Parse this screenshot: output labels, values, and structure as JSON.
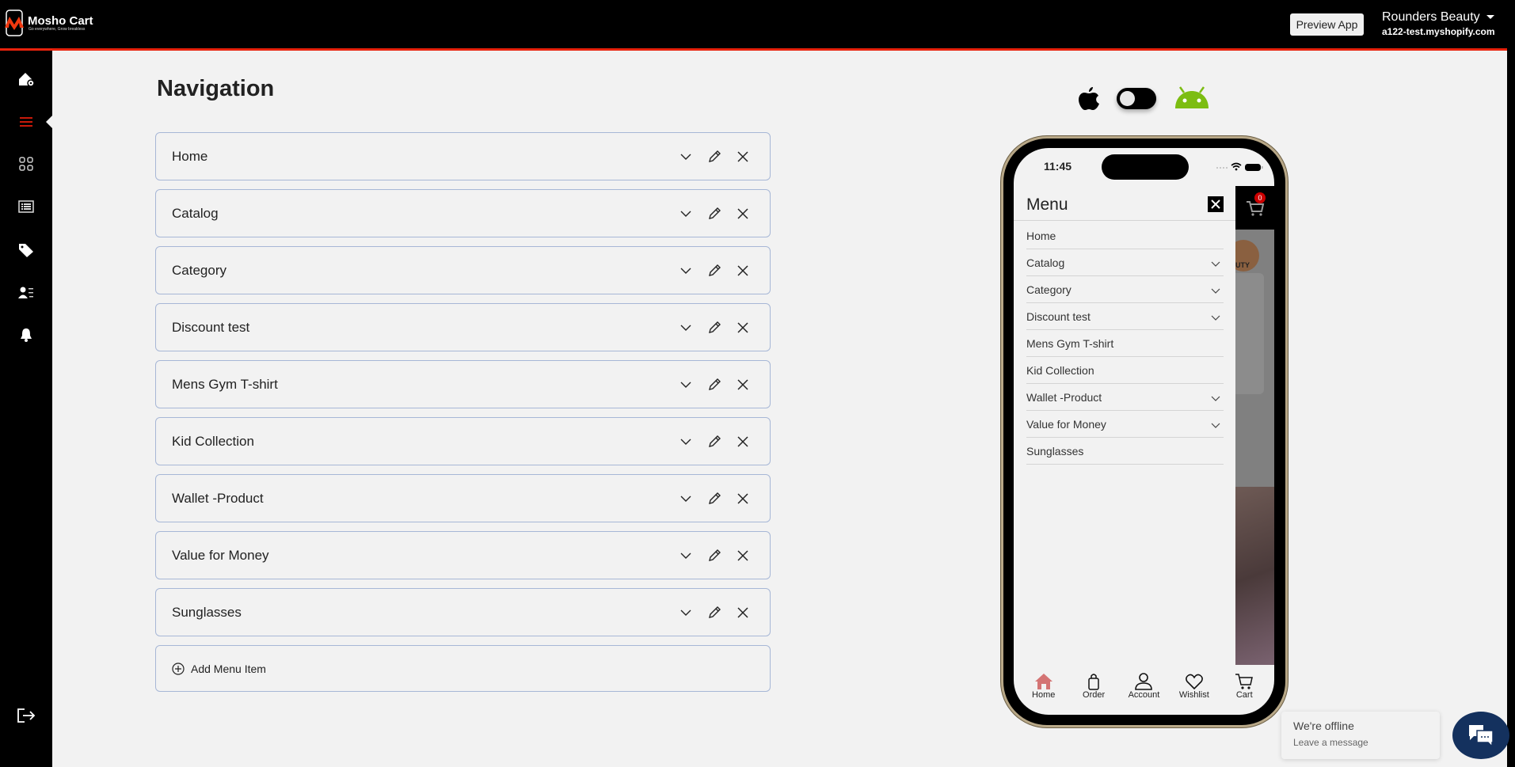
{
  "header": {
    "brand": "Mosho Cart",
    "tagline": "Go everywhere, Grow breakless",
    "preview_label": "Preview App",
    "store_name": "Rounders Beauty",
    "store_domain": "a122-test.myshopify.com",
    "accent": "#e8220c"
  },
  "sidebar": {
    "items": [
      {
        "icon": "home-settings-icon"
      },
      {
        "icon": "menu-icon",
        "active": true
      },
      {
        "icon": "grid-icon"
      },
      {
        "icon": "list-icon"
      },
      {
        "icon": "tag-icon"
      },
      {
        "icon": "user-list-icon"
      },
      {
        "icon": "bell-icon"
      }
    ],
    "logout_icon": "logout-icon"
  },
  "page": {
    "title": "Navigation",
    "items": [
      "Home",
      "Catalog",
      "Category",
      "Discount test",
      "Mens Gym T-shirt",
      "Kid Collection",
      "Wallet -Product",
      "Value for Money",
      "Sunglasses"
    ],
    "add_label": "Add Menu Item"
  },
  "platform": {
    "selected": "ios",
    "ios_icon": "apple-icon",
    "android_icon": "android-icon",
    "android_color": "#7cbd12"
  },
  "phone": {
    "time": "11:45",
    "menu_title": "Menu",
    "cart_badge": "0",
    "peek_text": "UTY",
    "menu_items": [
      {
        "label": "Home",
        "expandable": false
      },
      {
        "label": "Catalog",
        "expandable": true
      },
      {
        "label": "Category",
        "expandable": true
      },
      {
        "label": "Discount test",
        "expandable": true
      },
      {
        "label": "Mens Gym T-shirt",
        "expandable": false
      },
      {
        "label": "Kid Collection",
        "expandable": false
      },
      {
        "label": "Wallet -Product",
        "expandable": true
      },
      {
        "label": "Value for Money",
        "expandable": true
      },
      {
        "label": "Sunglasses",
        "expandable": false
      }
    ],
    "bottom_nav": [
      "Home",
      "Order",
      "Account",
      "Wishlist",
      "Cart"
    ],
    "active_nav_color": "#d47474"
  },
  "chat": {
    "status": "We're offline",
    "prompt": "Leave a message",
    "color": "#14315e"
  }
}
